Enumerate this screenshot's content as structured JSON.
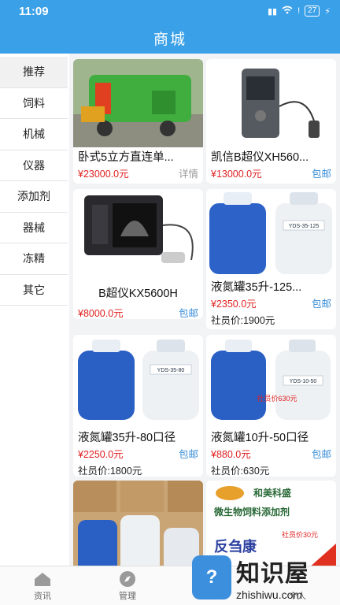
{
  "status": {
    "time": "11:09",
    "battery": "27"
  },
  "title": "商城",
  "sidebar": {
    "items": [
      {
        "label": "推荐"
      },
      {
        "label": "饲料"
      },
      {
        "label": "机械"
      },
      {
        "label": "仪器"
      },
      {
        "label": "添加剂"
      },
      {
        "label": "器械"
      },
      {
        "label": "冻精"
      },
      {
        "label": "其它"
      }
    ]
  },
  "products": [
    {
      "name": "卧式5立方直连单...",
      "price": "¥23000.0元",
      "tag": "详情"
    },
    {
      "name": "凯信B超仪XH560...",
      "price": "¥13000.0元",
      "tag": "包邮"
    },
    {
      "name": "B超仪KX5600H",
      "price": "¥8000.0元",
      "tag": "包邮"
    },
    {
      "name": "液氮罐35升-125...",
      "price": "¥2350.0元",
      "tag": "包邮",
      "member": "社员价:1900元",
      "image_labels": [
        "YDS-35-125"
      ]
    },
    {
      "name": "液氮罐35升-80口径",
      "price": "¥2250.0元",
      "tag": "包邮",
      "member": "社员价:1800元",
      "image_labels": [
        "YDS-35-80"
      ]
    },
    {
      "name": "液氮罐10升-50口径",
      "price": "¥880.0元",
      "tag": "包邮",
      "member": "社员价:630元",
      "image_labels": [
        "YDS-10-50",
        "社员价630元"
      ]
    },
    {
      "name": "",
      "price": "",
      "tag": ""
    },
    {
      "name": "",
      "price": "",
      "tag": "",
      "image_labels": [
        "和美科盛",
        "微生物饲料添加剂",
        "社员价30元",
        "反刍康"
      ]
    }
  ],
  "bottomnav": [
    {
      "label": "资讯",
      "icon": "home-icon"
    },
    {
      "label": "管理",
      "icon": "compass-icon"
    },
    {
      "label": "",
      "icon": "cart-icon"
    },
    {
      "label": "个人",
      "icon": "user-icon"
    }
  ],
  "watermark": {
    "cn": "知识屋",
    "url": "zhishiwu.com"
  },
  "colors": {
    "header": "#3aa0e8",
    "price": "#e02020",
    "tag": "#3a8ed8"
  }
}
